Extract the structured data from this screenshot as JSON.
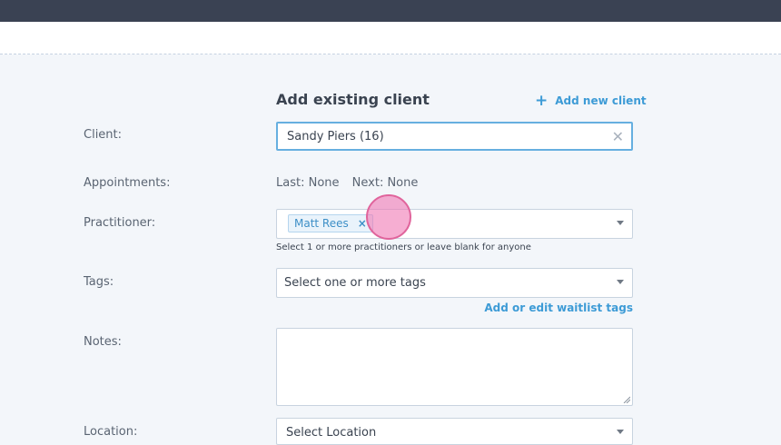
{
  "form": {
    "heading": "Add existing client",
    "add_new_client": "Add new client",
    "labels": {
      "client": "Client:",
      "appointments": "Appointments:",
      "practitioner": "Practitioner:",
      "tags": "Tags:",
      "notes": "Notes:",
      "location": "Location:"
    },
    "client_value": "Sandy Piers (16)",
    "appointments": {
      "last": "Last: None",
      "next": "Next: None"
    },
    "practitioner": {
      "chips": [
        "Matt Rees"
      ],
      "hint": "Select 1 or more practitioners or leave blank for anyone"
    },
    "tags": {
      "placeholder": "Select one or more tags",
      "edit_link": "Add or edit waitlist tags"
    },
    "location": {
      "placeholder": "Select Location"
    }
  },
  "icons": {
    "plus": "plus-icon",
    "clear": "close-icon",
    "remove_chip": "close-icon",
    "caret": "caret-down-icon"
  }
}
